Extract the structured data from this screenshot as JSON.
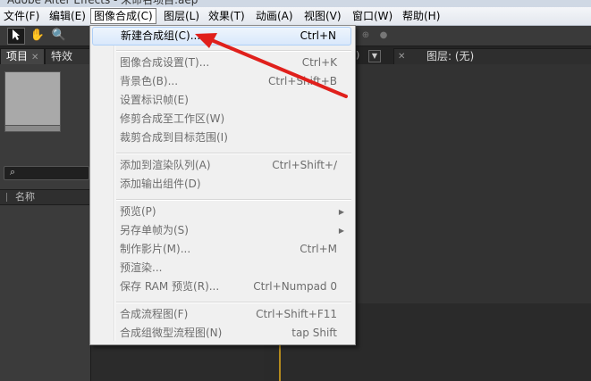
{
  "window": {
    "title": "Adobe After Effects - 未命名项目.aep"
  },
  "menubar": {
    "items": [
      {
        "label": "文件(F)"
      },
      {
        "label": "编辑(E)"
      },
      {
        "label": "图像合成(C)"
      },
      {
        "label": "图层(L)"
      },
      {
        "label": "效果(T)"
      },
      {
        "label": "动画(A)"
      },
      {
        "label": "视图(V)"
      },
      {
        "label": "窗口(W)"
      },
      {
        "label": "帮助(H)"
      }
    ]
  },
  "toolbar": {
    "tools": [
      "selection-tool-icon",
      "hand-tool-icon",
      "zoom-tool-icon"
    ]
  },
  "panels": {
    "project_tab": "项目",
    "effects_tab": "特效",
    "layer_tab": "图层: (无)",
    "column_name": "名称"
  },
  "dropdown": {
    "items": [
      {
        "label": "新建合成组(C)...",
        "shortcut": "Ctrl+N",
        "enabled": true,
        "highlight": true
      },
      {
        "separator": true
      },
      {
        "label": "图像合成设置(T)...",
        "shortcut": "Ctrl+K",
        "enabled": false
      },
      {
        "label": "背景色(B)...",
        "shortcut": "Ctrl+Shift+B",
        "enabled": false
      },
      {
        "label": "设置标识帧(E)",
        "shortcut": "",
        "enabled": false
      },
      {
        "label": "修剪合成至工作区(W)",
        "shortcut": "",
        "enabled": false
      },
      {
        "label": "裁剪合成到目标范围(I)",
        "shortcut": "",
        "enabled": false
      },
      {
        "separator": true
      },
      {
        "label": "添加到渲染队列(A)",
        "shortcut": "Ctrl+Shift+/",
        "enabled": false
      },
      {
        "label": "添加输出组件(D)",
        "shortcut": "",
        "enabled": false
      },
      {
        "separator": true
      },
      {
        "label": "预览(P)",
        "shortcut": "",
        "enabled": false,
        "submenu": true
      },
      {
        "label": "另存单帧为(S)",
        "shortcut": "",
        "enabled": false,
        "submenu": true
      },
      {
        "label": "制作影片(M)...",
        "shortcut": "Ctrl+M",
        "enabled": false
      },
      {
        "label": "预渲染...",
        "shortcut": "",
        "enabled": false
      },
      {
        "label": "保存 RAM 预览(R)...",
        "shortcut": "Ctrl+Numpad 0",
        "enabled": false
      },
      {
        "separator": true
      },
      {
        "label": "合成流程图(F)",
        "shortcut": "Ctrl+Shift+F11",
        "enabled": false
      },
      {
        "label": "合成组微型流程图(N)",
        "shortcut": "tap Shift",
        "enabled": false
      }
    ]
  },
  "colors": {
    "annotation_arrow": "#e0201c",
    "menu_highlight": "#d9e8fb"
  }
}
